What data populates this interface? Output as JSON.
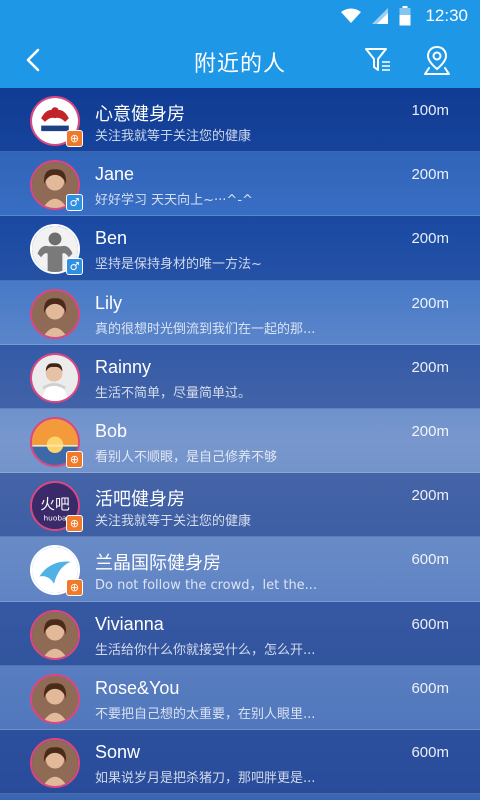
{
  "status": {
    "time": "12:30"
  },
  "header": {
    "title": "附近的人"
  },
  "people": [
    {
      "name": "心意健身房",
      "sig": "关注我就等于关注您的健康",
      "dist": "100m",
      "badge": "gym",
      "badge_glyph": "⊕"
    },
    {
      "name": "Jane",
      "sig": "好好学习 天天向上~···^-^",
      "dist": "200m",
      "badge": "male",
      "badge_glyph": "♂"
    },
    {
      "name": "Ben",
      "sig": "坚持是保持身材的唯一方法~",
      "dist": "200m",
      "badge": "male",
      "badge_glyph": "♂"
    },
    {
      "name": "Lily",
      "sig": "真的很想时光倒流到我们在一起的那...",
      "dist": "200m",
      "badge": "",
      "badge_glyph": ""
    },
    {
      "name": "Rainny",
      "sig": "生活不简单，尽量简单过。",
      "dist": "200m",
      "badge": "",
      "badge_glyph": ""
    },
    {
      "name": "Bob",
      "sig": "看别人不顺眼，是自己修养不够",
      "dist": "200m",
      "badge": "gym",
      "badge_glyph": "⊕"
    },
    {
      "name": "活吧健身房",
      "sig": "关注我就等于关注您的健康",
      "dist": "200m",
      "badge": "gym",
      "badge_glyph": "⊕",
      "avatar_text": "火吧",
      "avatar_sub": "huoba"
    },
    {
      "name": "兰晶国际健身房",
      "sig": "Do not follow the crowd，let the...",
      "dist": "600m",
      "badge": "gym",
      "badge_glyph": "⊕"
    },
    {
      "name": "Vivianna",
      "sig": "生活给你什么你就接受什么，怎么开...",
      "dist": "600m",
      "badge": "",
      "badge_glyph": ""
    },
    {
      "name": "Rose&You",
      "sig": "不要把自己想的太重要，在别人眼里...",
      "dist": "600m",
      "badge": "",
      "badge_glyph": ""
    },
    {
      "name": "Sonw",
      "sig": "如果说岁月是把杀猪刀，那吧胖更是...",
      "dist": "600m",
      "badge": "",
      "badge_glyph": ""
    }
  ],
  "avatar_art": [
    "gym-logo",
    "woman-portrait",
    "bodybuilder",
    "woman-portrait",
    "woman-towel",
    "sunset",
    "huoba-logo",
    "blue-wave-logo",
    "woman-portrait",
    "woman-portrait",
    "woman-portrait"
  ]
}
